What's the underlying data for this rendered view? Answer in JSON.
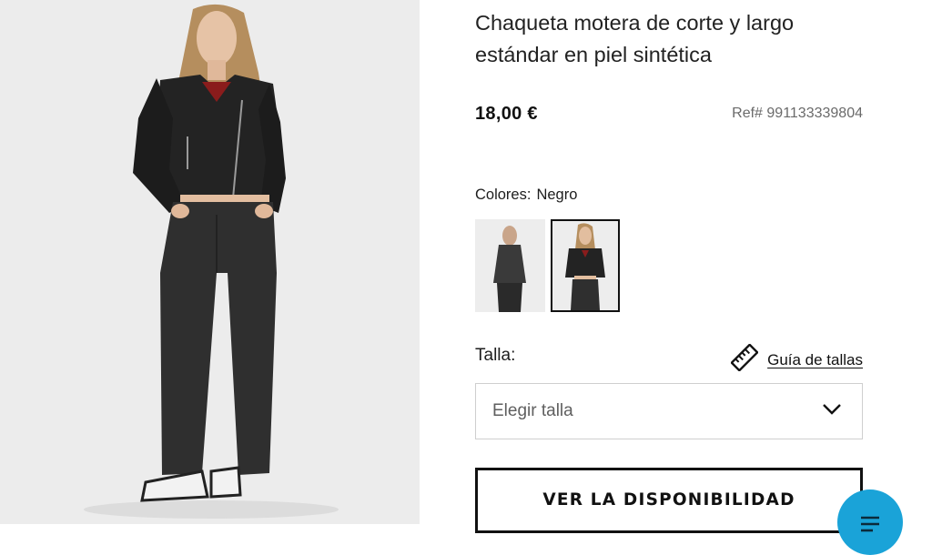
{
  "product": {
    "title": "Chaqueta motera de corte y largo estándar en piel sintética",
    "price": "18,00 €",
    "reference": "Ref# 991133339804"
  },
  "colors": {
    "label": "Colores:",
    "selected": "Negro"
  },
  "size": {
    "label": "Talla:",
    "guide_label": "Guía de tallas",
    "select_placeholder": "Elegir talla"
  },
  "actions": {
    "availability_label": "VER LA DISPONIBILIDAD"
  },
  "icons": {
    "size_guide": "ruler-icon",
    "dropdown": "chevron-down-icon",
    "chat": "chat-icon"
  },
  "theme": {
    "chat_button": "#1aa3d8",
    "border_selected": "#111111"
  }
}
